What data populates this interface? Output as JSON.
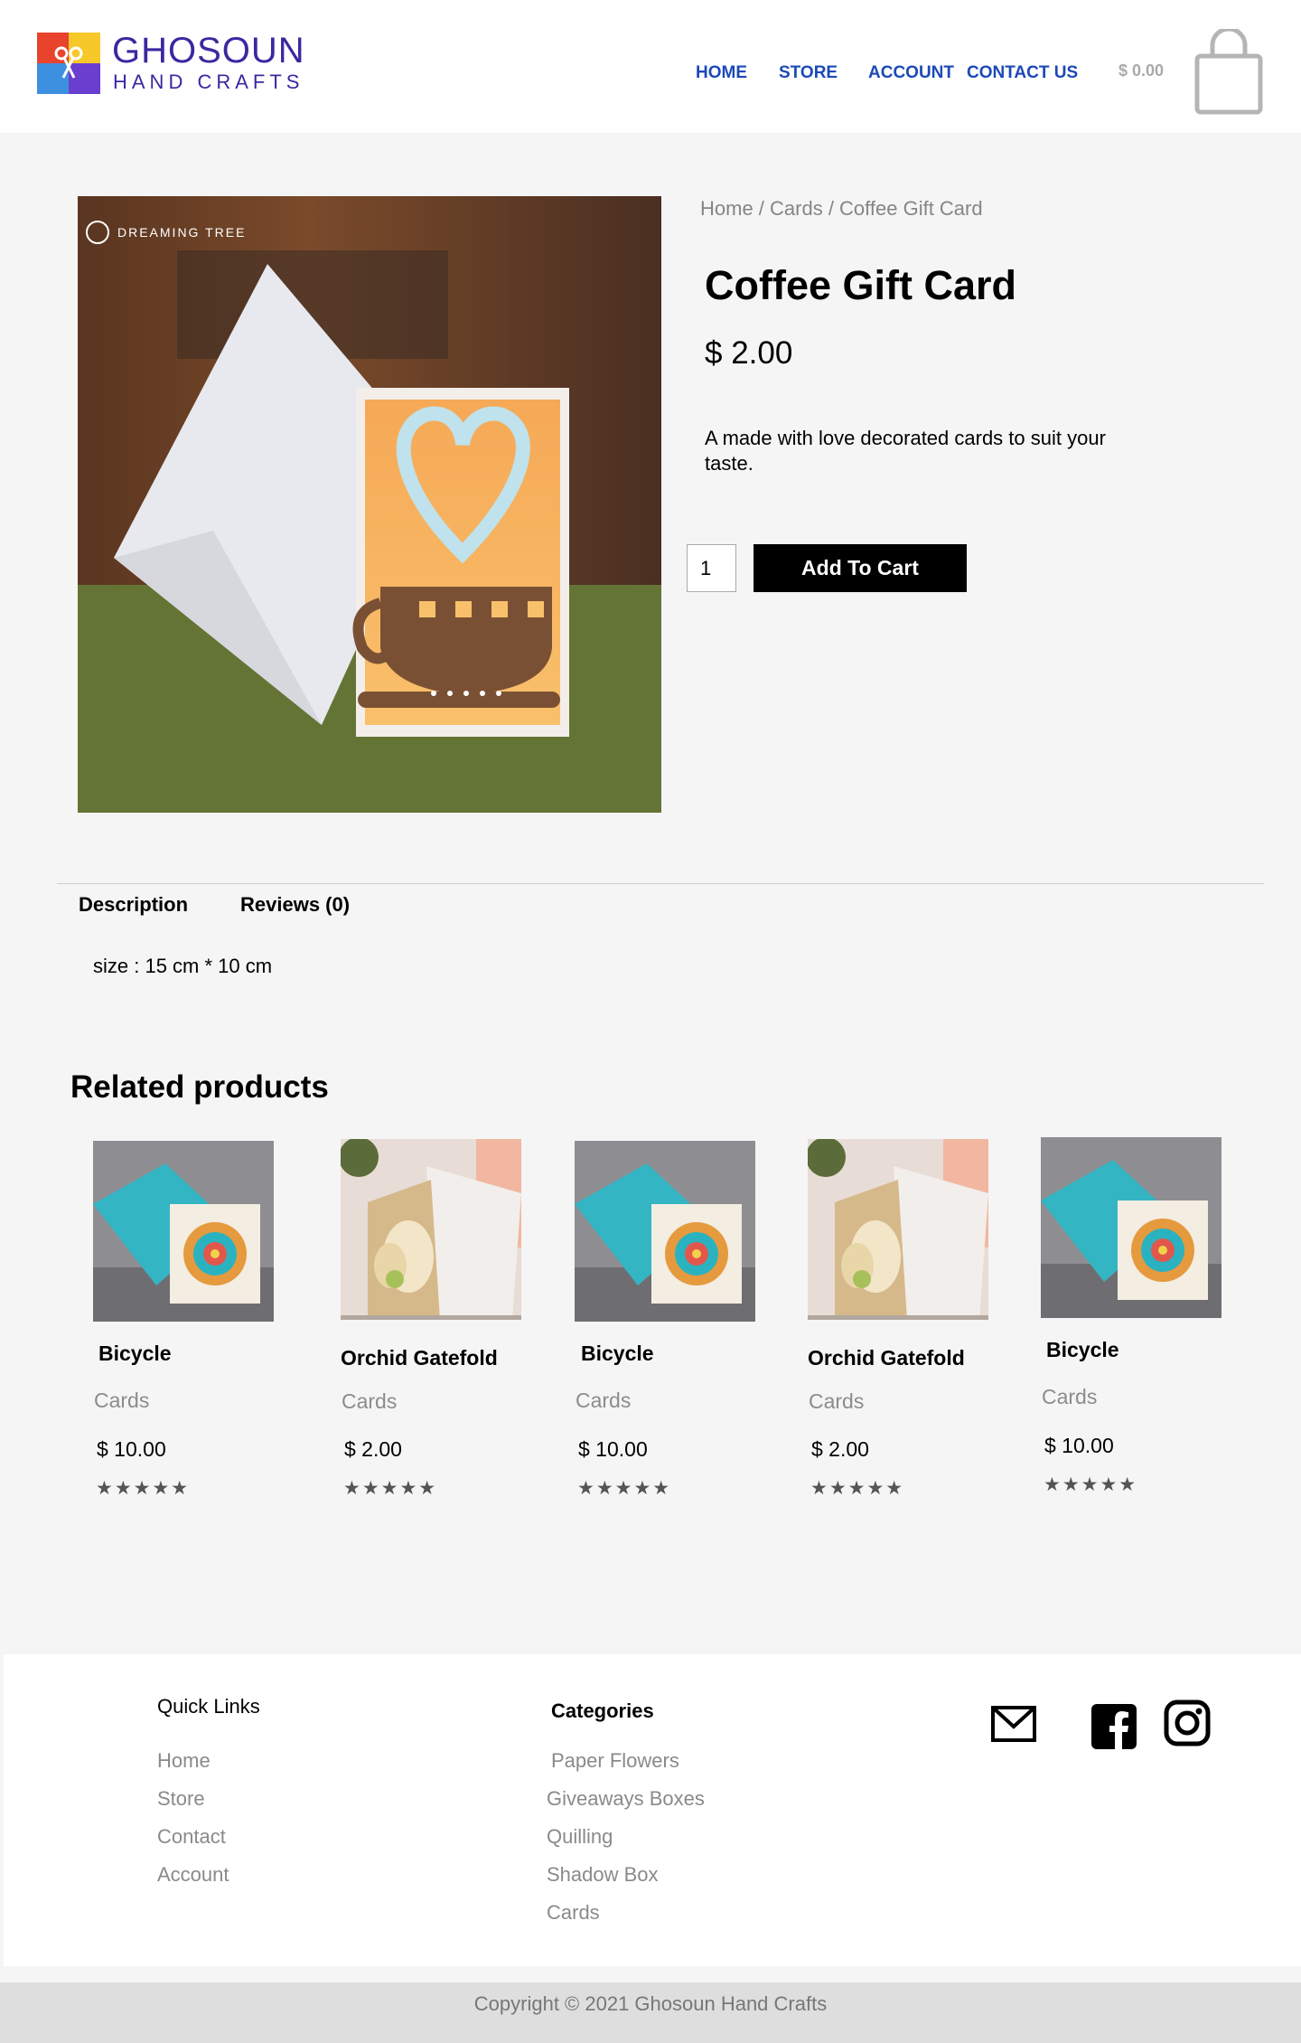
{
  "header": {
    "brand_line1": "GHOSOUN",
    "brand_line2": "HAND CRAFTS",
    "nav": [
      "HOME",
      "STORE",
      "ACCOUNT",
      "CONTACT US"
    ],
    "cart_total": "$ 0.00",
    "colors": {
      "brand": "#3b28a0",
      "nav": "#1c49b8"
    }
  },
  "product": {
    "image_watermark": "DREAMING TREE",
    "breadcrumb": "Home / Cards / Coffee Gift Card",
    "title": "Coffee Gift Card",
    "price": "$ 2.00",
    "description": "A made with love decorated cards to suit your taste.",
    "quantity": "1",
    "add_to_cart": "Add To Cart"
  },
  "tabs": {
    "items": [
      "Description",
      "Reviews (0)"
    ],
    "content": "size : 15 cm * 10 cm"
  },
  "related": {
    "title": "Related products",
    "items": [
      {
        "name": "Bicycle",
        "category": "Cards",
        "price": "$ 10.00",
        "rating": "★★★★★",
        "image": "teal-mandala-card"
      },
      {
        "name": "Orchid Gatefold",
        "category": "Cards",
        "price": "$ 2.00",
        "rating": "★★★★★",
        "image": "orchid-butterfly-card"
      },
      {
        "name": "Bicycle",
        "category": "Cards",
        "price": "$ 10.00",
        "rating": "★★★★★",
        "image": "teal-mandala-card"
      },
      {
        "name": "Orchid Gatefold",
        "category": "Cards",
        "price": "$ 2.00",
        "rating": "★★★★★",
        "image": "orchid-butterfly-card"
      },
      {
        "name": "Bicycle",
        "category": "Cards",
        "price": "$ 10.00",
        "rating": "★★★★★",
        "image": "teal-mandala-card"
      }
    ]
  },
  "footer": {
    "quick_links_title": "Quick Links",
    "quick_links": [
      "Home",
      "Store",
      "Contact",
      "Account"
    ],
    "categories_title": "Categories",
    "categories": [
      "Paper Flowers",
      "Giveaways Boxes",
      "Quilling",
      "Shadow Box",
      "Cards"
    ],
    "social_icons": [
      "mail-icon",
      "facebook-icon",
      "instagram-icon"
    ],
    "copyright": "Copyright © 2021 Ghosoun Hand Crafts"
  }
}
